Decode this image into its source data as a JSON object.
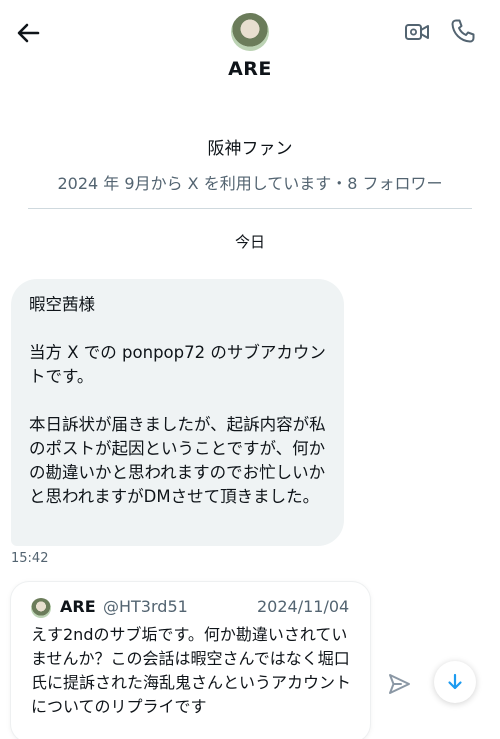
{
  "header": {
    "title": "ARE",
    "back_icon": "arrow-left-icon",
    "video_icon": "video-camera-icon",
    "phone_icon": "phone-icon"
  },
  "profile": {
    "display_name": "阪神ファン",
    "meta": "2024 年 9月から X を利用しています・8 フォロワー"
  },
  "conversation": {
    "day_label": "今日",
    "message": {
      "text": "暇空茜様\n\n当方 X での ponpop72 のサブアカウントです。\n\n本日訴状が届きましたが、起訴内容が私のポストが起因ということですが、何かの勘違いかと思われますのでお忙しいかと思われますがDMさせて頂きました。",
      "time": "15:42"
    },
    "quoted_post": {
      "name": "ARE",
      "handle": "@HT3rd51",
      "date": "2024/11/04",
      "text": "えす2ndのサブ垢です。何か勘違いされていませんか？この会話は暇空さんではなく堀口氏に提訴された海乱鬼さんというアカウントについてのリプライです"
    }
  },
  "actions": {
    "send_icon": "send-icon",
    "scroll_down_icon": "arrow-down-icon"
  },
  "colors": {
    "bubble_bg": "#eff3f4",
    "secondary_text": "#536471",
    "accent": "#1d9bf0"
  }
}
